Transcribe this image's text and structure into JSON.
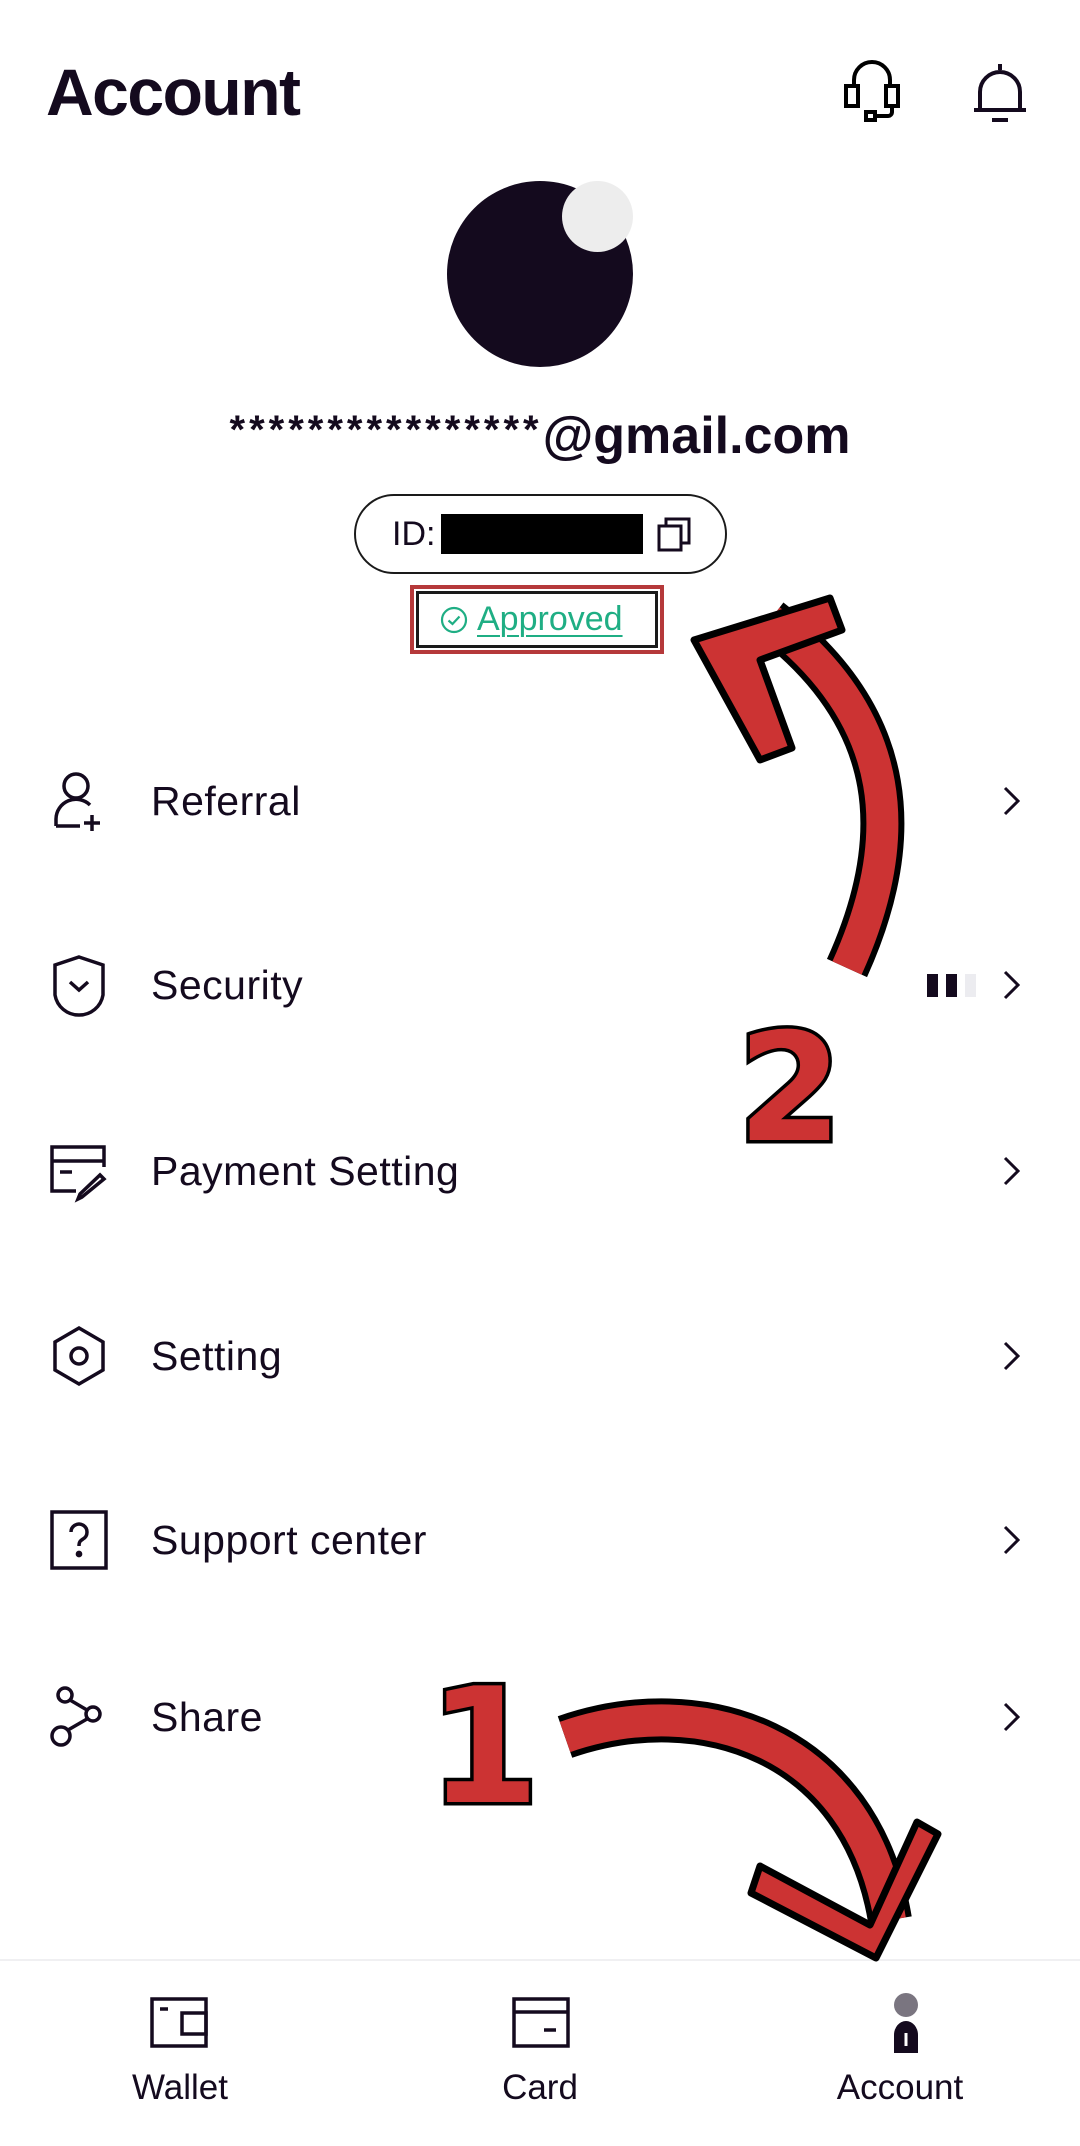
{
  "header": {
    "title": "Account",
    "icons": [
      "headset-icon",
      "bell-icon"
    ]
  },
  "profile": {
    "email_mask": "****************",
    "email_domain": "@gmail.com",
    "id_label": "ID:",
    "id_value_redacted": true,
    "verification_status": "Approved",
    "status_color": "#1fae84"
  },
  "menu": {
    "items": [
      {
        "label": "Referral",
        "icon": "user-plus-icon"
      },
      {
        "label": "Security",
        "icon": "shield-check-icon",
        "security_level": 2,
        "security_level_max": 3
      },
      {
        "label": "Payment Setting",
        "icon": "card-edit-icon"
      },
      {
        "label": "Setting",
        "icon": "hexagon-gear-icon"
      },
      {
        "label": "Support center",
        "icon": "question-box-icon"
      },
      {
        "label": "Share",
        "icon": "share-icon"
      }
    ]
  },
  "bottom_nav": {
    "items": [
      {
        "label": "Wallet",
        "icon": "wallet-icon",
        "active": false
      },
      {
        "label": "Card",
        "icon": "card-icon",
        "active": false
      },
      {
        "label": "Account",
        "icon": "account-icon",
        "active": true
      }
    ]
  },
  "annotations": {
    "step_1": "1",
    "step_2": "2",
    "color": "#cc3333"
  }
}
